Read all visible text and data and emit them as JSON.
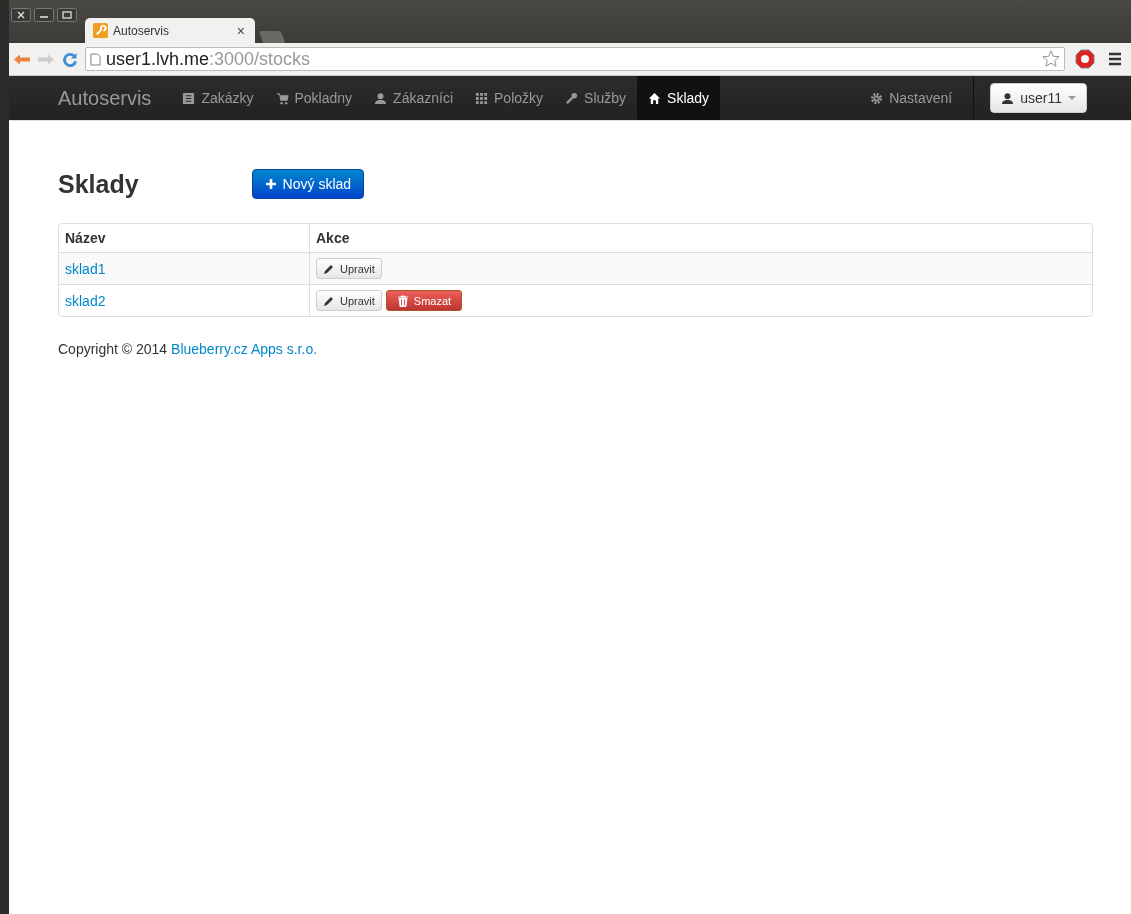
{
  "browser": {
    "tab_title": "Autoservis",
    "tab_close": "×",
    "url": {
      "host": "user1.lvh.me",
      "path": ":3000/stocks"
    }
  },
  "navbar": {
    "brand": "Autoservis",
    "items": [
      {
        "label": "Zakázky",
        "kind": "list",
        "selected": false
      },
      {
        "label": "Pokladny",
        "kind": "cart",
        "selected": false
      },
      {
        "label": "Zákazníci",
        "kind": "user",
        "selected": false
      },
      {
        "label": "Položky",
        "kind": "grid",
        "selected": false
      },
      {
        "label": "Služby",
        "kind": "wrench",
        "selected": false
      },
      {
        "label": "Sklady",
        "kind": "home",
        "selected": true
      }
    ],
    "settings": "Nastavení",
    "user": "user11"
  },
  "page": {
    "title": "Sklady",
    "new_button": "Nový sklad"
  },
  "table": {
    "columns": [
      "Název",
      "Akce"
    ],
    "rows": [
      {
        "name": "sklad1",
        "actions": [
          {
            "kind": "edit",
            "label": "Upravit"
          }
        ]
      },
      {
        "name": "sklad2",
        "actions": [
          {
            "kind": "edit",
            "label": "Upravit"
          },
          {
            "kind": "delete",
            "label": "Smazat"
          }
        ]
      }
    ]
  },
  "footer": {
    "text": "Copyright © 2014",
    "link": "Blueberry.cz Apps s.r.o."
  }
}
